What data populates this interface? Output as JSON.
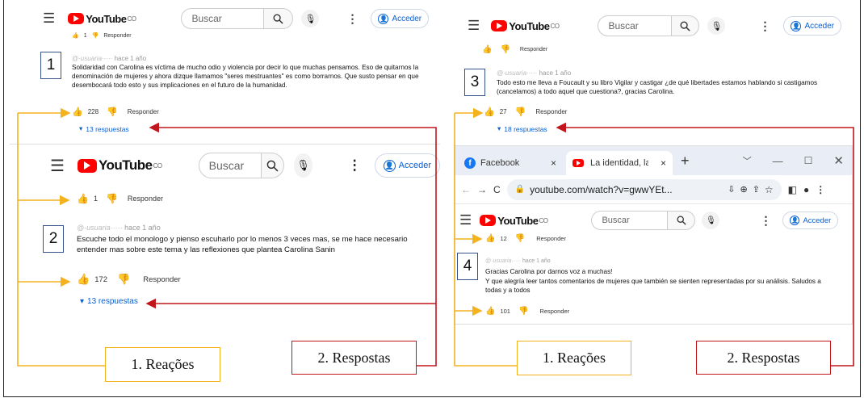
{
  "youtube": {
    "logo": "YouTube",
    "country": "CO",
    "search_placeholder": "Buscar",
    "signin": "Acceder"
  },
  "actions": {
    "reply": "Responder"
  },
  "comments": {
    "c1": {
      "label": "1",
      "time": "hace 1 año",
      "prev_likes": "1",
      "text": "Solidaridad con Carolina es víctima de mucho odio y violencia por decir lo que muchas pensamos. Eso de quitarnos la denominación de mujeres y ahora dizque llamamos \"seres mestruantes\" es como borrarnos. Que susto pensar en que desembocará todo esto y sus implicaciones en el futuro de la humanidad.",
      "likes": "228",
      "replies": "13 respuestas"
    },
    "c2": {
      "label": "2",
      "time": "hace 1 año",
      "prev_likes": "1",
      "text": "Escuche todo el monologo y pienso escuharlo por lo menos 3 veces mas,  se me hace necesario entender mas sobre este tema y las reflexiones que plantea Carolina Sanin",
      "likes": "172",
      "replies": "13 respuestas"
    },
    "c3": {
      "label": "3",
      "time": "hace 1 año",
      "text": "Todo esto me lleva a Foucault y su libro Vigilar y castigar ¿de qué libertades estamos hablando si castigamos (cancelamos) a todo aquel que cuestiona?, gracias Carolina.",
      "likes": "27",
      "replies": "18 respuestas"
    },
    "c4": {
      "label": "4",
      "time": "hace 1 año",
      "prev_likes": "12",
      "text1": "Gracias Carolina por darnos voz a muchas!",
      "text2": "Y que alegría leer tantos comentarios de mujeres que también se sienten representadas por su análisis. Saludos a todas y a todos",
      "likes": "101"
    }
  },
  "browser": {
    "tab1": "Facebook",
    "tab2": "La identidad, las",
    "url": "youtube.com/watch?v=gwwYEt..."
  },
  "labels": {
    "reacoes": "1. Reações",
    "respostas": "2. Respostas"
  },
  "colors": {
    "reactions_line": "#f4b21f",
    "replies_line": "#c0161c",
    "accent": "#065fd4"
  }
}
